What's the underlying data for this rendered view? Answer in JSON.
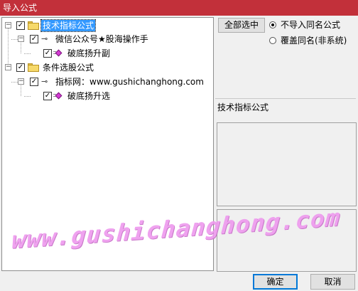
{
  "window": {
    "title": "导入公式"
  },
  "tree": {
    "root1": {
      "label": "技术指标公式",
      "checked": true,
      "expanded": true,
      "icon": "folder-icon",
      "child": {
        "label": "微信公众号★股海操作手",
        "checked": true,
        "icon": "key-icon",
        "leaf": {
          "label": "破底扬升副",
          "checked": true,
          "icon": "formula-icon"
        }
      }
    },
    "root2": {
      "label": "条件选股公式",
      "checked": true,
      "expanded": true,
      "icon": "folder-icon",
      "child": {
        "label": "指标网：www.gushichanghong.com",
        "checked": true,
        "icon": "key-icon",
        "leaf": {
          "label": "破底扬升选",
          "checked": true,
          "icon": "formula-icon"
        }
      }
    }
  },
  "right_panel": {
    "select_all_label": "全部选中",
    "options": [
      {
        "label": "不导入同名公式",
        "selected": true
      },
      {
        "label": "覆盖同名(非系统)",
        "selected": false
      }
    ],
    "info_label": "技术指标公式"
  },
  "footer": {
    "ok_label": "确定",
    "cancel_label": "取消"
  },
  "watermark": {
    "text": "www.gushichanghong.com"
  },
  "colors": {
    "titlebar": "#c2303a",
    "selection": "#3399ff",
    "watermark": "#ee99ee"
  }
}
